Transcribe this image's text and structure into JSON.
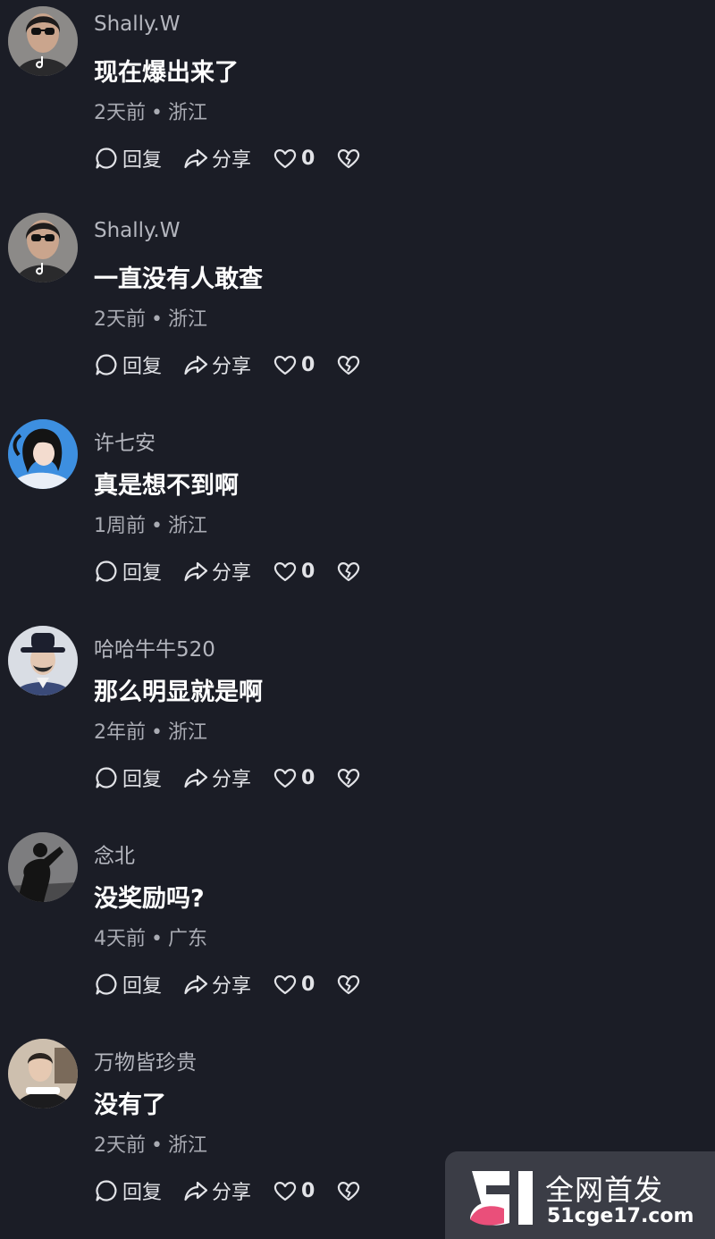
{
  "comments": [
    {
      "username": "Shally.W",
      "text": "现在爆出来了",
      "time": "2天前",
      "location": "浙江",
      "reply_label": "回复",
      "share_label": "分享",
      "likes": "0",
      "avatar_icon": "woman-sunglasses-avatar"
    },
    {
      "username": "Shally.W",
      "text": "一直没有人敢查",
      "time": "2天前",
      "location": "浙江",
      "reply_label": "回复",
      "share_label": "分享",
      "likes": "0",
      "avatar_icon": "woman-sunglasses-avatar"
    },
    {
      "username": "许七安",
      "text": "真是想不到啊",
      "time": "1周前",
      "location": "浙江",
      "reply_label": "回复",
      "share_label": "分享",
      "likes": "0",
      "avatar_icon": "anime-girl-avatar"
    },
    {
      "username": "哈哈牛牛520",
      "text": "那么明显就是啊",
      "time": "2年前",
      "location": "浙江",
      "reply_label": "回复",
      "share_label": "分享",
      "likes": "0",
      "avatar_icon": "man-hat-avatar"
    },
    {
      "username": "念北",
      "text": "没奖励吗?",
      "time": "4天前",
      "location": "广东",
      "reply_label": "回复",
      "share_label": "分享",
      "likes": "0",
      "avatar_icon": "silhouette-avatar"
    },
    {
      "username": "万物皆珍贵",
      "text": "没有了",
      "time": "2天前",
      "location": "浙江",
      "reply_label": "回复",
      "share_label": "分享",
      "likes": "0",
      "avatar_icon": "man-portrait-avatar"
    }
  ],
  "separator": "•",
  "watermark": {
    "title": "全网首发",
    "site": "51cge17.com"
  },
  "colors": {
    "background": "#1b1d26",
    "username": "#b4b6be",
    "meta": "#a9abb3",
    "text": "#ffffff"
  }
}
